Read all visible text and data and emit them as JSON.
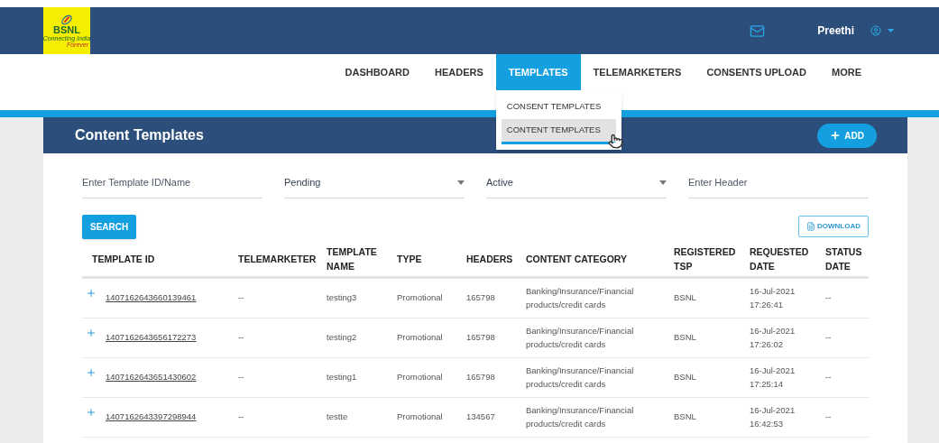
{
  "logo": {
    "name": "BSNL",
    "tagline": "Connecting India",
    "tagline_2": "Forever"
  },
  "user": {
    "name": "Preethi"
  },
  "nav": [
    {
      "label": "DASHBOARD",
      "selected": false
    },
    {
      "label": "HEADERS",
      "selected": false
    },
    {
      "label": "TEMPLATES",
      "selected": true
    },
    {
      "label": "TELEMARKETERS",
      "selected": false
    },
    {
      "label": "CONSENTS UPLOAD",
      "selected": false
    },
    {
      "label": "MORE",
      "selected": false
    }
  ],
  "templates_menu": [
    {
      "label": "CONSENT TEMPLATES",
      "selected": false
    },
    {
      "label": "CONTENT TEMPLATES",
      "selected": true
    }
  ],
  "card": {
    "title": "Content Templates",
    "add_button": "ADD"
  },
  "filters": [
    {
      "kind": "input",
      "placeholder": "Enter Template ID/Name"
    },
    {
      "kind": "select",
      "value": "Pending"
    },
    {
      "kind": "select",
      "value": "Active"
    },
    {
      "kind": "input",
      "placeholder": "Enter Header"
    }
  ],
  "search_button": "SEARCH",
  "download_button": "DOWNLOAD",
  "table": {
    "columns": [
      [
        "TEMPLATE ID"
      ],
      [
        "TELEMARKETER"
      ],
      [
        "TEMPLATE",
        "NAME"
      ],
      [
        "TYPE"
      ],
      [
        "HEADERS"
      ],
      [
        "CONTENT CATEGORY"
      ],
      [
        "REGISTERED",
        "TSP"
      ],
      [
        "REQUESTED",
        "DATE"
      ],
      [
        "STATUS",
        "DATE"
      ]
    ],
    "rows": [
      {
        "id": "1407162643660139461",
        "telemarketer": "--",
        "name": "testing3",
        "type": "Promotional",
        "headers": "165798",
        "category": [
          "Banking/Insurance/Financial",
          "products/credit cards"
        ],
        "tsp": "BSNL",
        "requested": [
          "16-Jul-2021",
          "17:26:41"
        ],
        "status_date": "--"
      },
      {
        "id": "1407162643656172273",
        "telemarketer": "--",
        "name": "testing2",
        "type": "Promotional",
        "headers": "165798",
        "category": [
          "Banking/Insurance/Financial",
          "products/credit cards"
        ],
        "tsp": "BSNL",
        "requested": [
          "16-Jul-2021",
          "17:26:02"
        ],
        "status_date": "--"
      },
      {
        "id": "1407162643651430602",
        "telemarketer": "--",
        "name": "testing1",
        "type": "Promotional",
        "headers": "165798",
        "category": [
          "Banking/Insurance/Financial",
          "products/credit cards"
        ],
        "tsp": "BSNL",
        "requested": [
          "16-Jul-2021",
          "17:25:14"
        ],
        "status_date": "--"
      },
      {
        "id": "1407162643397298944",
        "telemarketer": "--",
        "name": "testte",
        "type": "Promotional",
        "headers": "134567",
        "category": [
          "Banking/Insurance/Financial",
          "products/credit cards"
        ],
        "tsp": "BSNL",
        "requested": [
          "16-Jul-2021",
          "16:42:53"
        ],
        "status_date": "--"
      }
    ]
  }
}
